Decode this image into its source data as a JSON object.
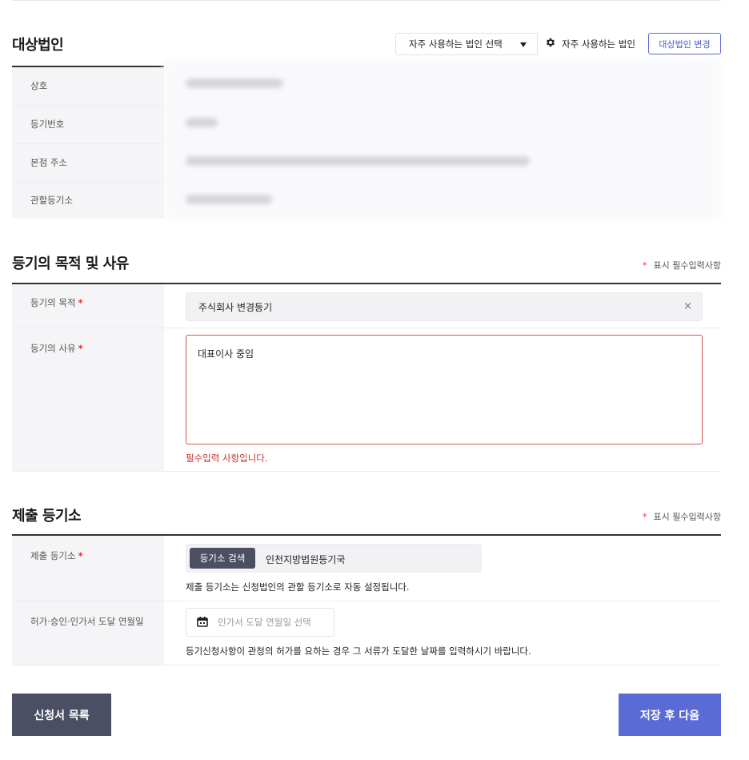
{
  "corp_section": {
    "title": "대상법인",
    "fav_select_value": "자주 사용하는 법인 선택",
    "fav_link": "자주 사용하는 법인",
    "change_button": "대상법인 변경",
    "rows": [
      {
        "label": "상호"
      },
      {
        "label": "등기번호"
      },
      {
        "label": "본점 주소"
      },
      {
        "label": "관할등기소"
      }
    ]
  },
  "purpose_section": {
    "title": "등기의 목적 및 사유",
    "required_note": "표시 필수입력사항",
    "purpose_label": "등기의 목적",
    "purpose_value": "주식회사 변경등기",
    "clear_glyph": "×",
    "reason_label": "등기의 사유",
    "reason_value": "대표이사 중임",
    "error_text": "필수입력 사항입니다."
  },
  "office_section": {
    "title": "제출 등기소",
    "required_note": "표시 필수입력사항",
    "office_label": "제출 등기소",
    "search_button": "등기소 검색",
    "office_value": "인천지방법원등기국",
    "office_hint": "제출 등기소는 신청법인의 관할 등기소로 자동 설정됩니다.",
    "date_label": "허가·승인·인가서 도달 연월일",
    "date_placeholder": "인가서 도달 연월일 선택",
    "date_hint": "등기신청사항이 관청의 허가를 요하는 경우 그 서류가 도달한 날짜를 입력하시기 바랍니다."
  },
  "required_star": "*",
  "footer": {
    "list_button": "신청서 목록",
    "next_button": "저장 후 다음"
  },
  "colors": {
    "accent": "#5a6bd6",
    "dark_button": "#4b4f63",
    "error": "#c9302c",
    "label_bg": "#f5f5f7"
  }
}
